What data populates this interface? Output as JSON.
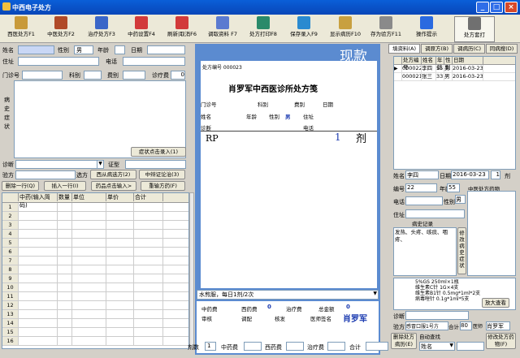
{
  "window": {
    "title": "中西电子处方"
  },
  "toolbar": [
    {
      "label": "西医处方F1",
      "icon": "pen-icon",
      "color": "#c89a3a"
    },
    {
      "label": "中医处方F2",
      "icon": "herb-icon",
      "color": "#b04a28"
    },
    {
      "label": "治疗处方F3",
      "icon": "book-icon",
      "color": "#3a66c8"
    },
    {
      "label": "中药设置F4",
      "icon": "close-doc-icon",
      "color": "#d23a3a"
    },
    {
      "label": "刷新|取消F6",
      "icon": "no-entry-icon",
      "color": "#d23a3a"
    },
    {
      "label": "调取资料 F7",
      "icon": "wrench-icon",
      "color": "#5a7ad0"
    },
    {
      "label": "处方打印F8",
      "icon": "monitor-icon",
      "color": "#2a8a6a"
    },
    {
      "label": "保存录入F9",
      "icon": "save-icon",
      "color": "#2a8ad0"
    },
    {
      "label": "显示病历F10",
      "icon": "document-icon",
      "color": "#c8a040"
    },
    {
      "label": "存为验方F11",
      "icon": "check-pen-icon",
      "color": "#8a8a8a"
    },
    {
      "label": "操作提示",
      "icon": "help-icon",
      "color": "#2a6ae0"
    },
    {
      "label": "处方套打",
      "icon": "printer-icon",
      "color": "#707070"
    }
  ],
  "left": {
    "name_label": "姓名",
    "gender_label": "性别",
    "gender_value": "男",
    "age_label": "年龄",
    "date_label": "日期",
    "address_label": "住址",
    "phone_label": "电话",
    "clinic_no_label": "门诊号",
    "dept_label": "科别",
    "fee_type_label": "费别",
    "treat_fee_label": "诊疗费",
    "treat_fee_value": "0",
    "history_label": "病史症状",
    "symptom_btn": "症状点击录入(1)",
    "diagnosis_label": "诊断",
    "cert_label": "证型",
    "rx_label": "验方",
    "rx_type_label": "选方",
    "west_btn": "西从病选方(2)",
    "tcm_btn": "中辩证论治(3)",
    "del_btn": "删除一行(Q)",
    "ins_btn": "插入一行(I)",
    "drug_btn": "药品点击输入>",
    "resort_btn": "重输方药(F)",
    "grid_headers": [
      "",
      "中药(输入简码)",
      "数量",
      "单位",
      "单价",
      "合计"
    ],
    "grid_rows": [
      "1",
      "2",
      "3",
      "4",
      "5",
      "6",
      "7",
      "8",
      "9",
      "10",
      "11",
      "12",
      "13",
      "14",
      "15",
      "16"
    ]
  },
  "rx": {
    "watermark": "现款",
    "rx_no": "处方编号 000023",
    "hospital": "肖罗军中西医诊所处方笺",
    "row1": [
      "门诊号",
      "科别",
      "费别",
      "日期"
    ],
    "row2": [
      "姓名",
      "年龄",
      "性别",
      "男",
      "住址"
    ],
    "row3": [
      "诊断",
      "电话"
    ],
    "rp": "RP",
    "count": "1",
    "unit": "剂",
    "usage": "水煎服，每日1剂/2次",
    "fee_labels": [
      "中药费",
      "西药费",
      "治疗费",
      "总金额"
    ],
    "fee_values": [
      "0",
      "0"
    ],
    "sign_labels": [
      "审核",
      "调配",
      "核发",
      "医师签名"
    ],
    "doctor": "肖罗军"
  },
  "right": {
    "tabs": [
      "填资料(A)",
      "调原方(B)",
      "调病历(C)",
      "同病搜(D)"
    ],
    "headers": [
      "处方编号",
      "姓名",
      "年龄",
      "性别",
      "日期"
    ],
    "records": [
      {
        "no": "000022",
        "name": "李四",
        "age": "55",
        "sex": "男",
        "date": "2016-03-23"
      },
      {
        "no": "000021",
        "name": "张三",
        "age": "33",
        "sex": "男",
        "date": "2016-03-23"
      }
    ],
    "name_label": "姓名",
    "name_value": "李四",
    "date_label": "日期",
    "date_value": "2016-03-23",
    "count": "1",
    "unit_label": "剂",
    "no_label": "编号",
    "no_value": "22",
    "age_label": "年龄",
    "age_value": "55",
    "phone_label": "电话",
    "sex_label": "性别",
    "sex_value": "男",
    "addr_label": "住址",
    "tcm_rx_label": "中医处方药物",
    "history_title": "病史记录",
    "history_text": "发热、头疼、咳痰、咽疼、",
    "edit_history_btn": "修改病史症状",
    "rx_text": [
      "5%GS 250ml×1瓶",
      "维生素C针 1G×4支",
      "维生素B1针 0.5mg*1ml*2支",
      "病毒唑针 0.1g*1ml*5支"
    ],
    "view_btn": "放大查看",
    "diag_label": "诊断",
    "rx_label": "验方",
    "rx_value": "感冒口服1号方",
    "total_label": "合计",
    "total_value": "80",
    "doctor_label": "医师",
    "doctor_value": "肖罗军",
    "del_btn": "删除处方病历(E)",
    "auto_label": "自动查找",
    "auto_value": "姓名",
    "mod_btn": "修改处方药物(F)"
  },
  "footer": {
    "count_label": "剂数",
    "count_value": "1",
    "chinese_label": "中药费",
    "west_label": "西药费",
    "treat_label": "治疗费",
    "total_label": "合计"
  }
}
